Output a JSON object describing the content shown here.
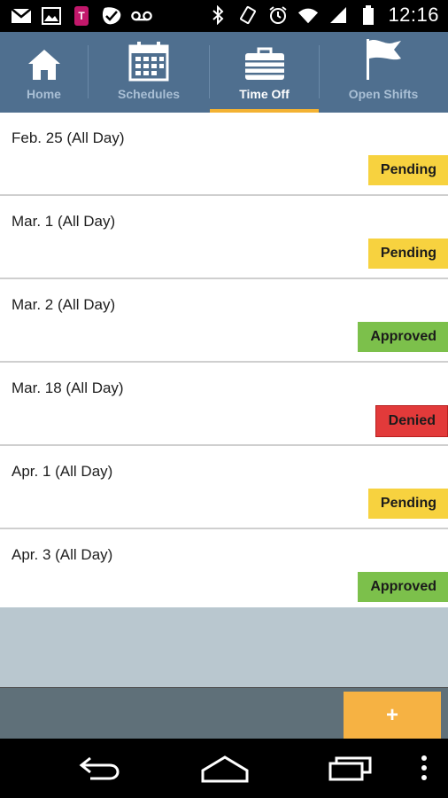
{
  "status_bar": {
    "time": "12:16",
    "left_icons": [
      "gmail-icon",
      "gallery-icon",
      "tmobile-icon",
      "check-icon",
      "voicemail-icon"
    ],
    "right_icons": [
      "bluetooth-icon",
      "vibrate-icon",
      "alarm-icon",
      "wifi-icon",
      "signal-icon",
      "battery-icon"
    ]
  },
  "tabs": [
    {
      "label": "Home",
      "icon": "home-icon",
      "active": false
    },
    {
      "label": "Schedules",
      "icon": "calendar-icon",
      "active": false
    },
    {
      "label": "Time Off",
      "icon": "briefcase-icon",
      "active": true
    },
    {
      "label": "Open Shifts",
      "icon": "flag-icon",
      "active": false
    }
  ],
  "requests": [
    {
      "date": "Feb. 25 (All Day)",
      "status": "Pending",
      "color": "#f7d23f"
    },
    {
      "date": "Mar. 1 (All Day)",
      "status": "Pending",
      "color": "#f7d23f"
    },
    {
      "date": "Mar. 2 (All Day)",
      "status": "Approved",
      "color": "#7cc04b"
    },
    {
      "date": "Mar. 18 (All Day)",
      "status": "Denied",
      "color": "#e23a3a"
    },
    {
      "date": "Apr. 1 (All Day)",
      "status": "Pending",
      "color": "#f7d23f"
    },
    {
      "date": "Apr. 3 (All Day)",
      "status": "Approved",
      "color": "#7cc04b"
    }
  ],
  "add_button": {
    "label": "+"
  },
  "colors": {
    "tabbar": "#4f6f8f",
    "active_underline": "#f3b233",
    "pending": "#f7d23f",
    "approved": "#7cc04b",
    "denied": "#e23a3a",
    "add_button": "#f6b243"
  },
  "nav": {
    "icons": [
      "back-icon",
      "home-nav-icon",
      "recents-icon",
      "overflow-menu-icon"
    ]
  }
}
